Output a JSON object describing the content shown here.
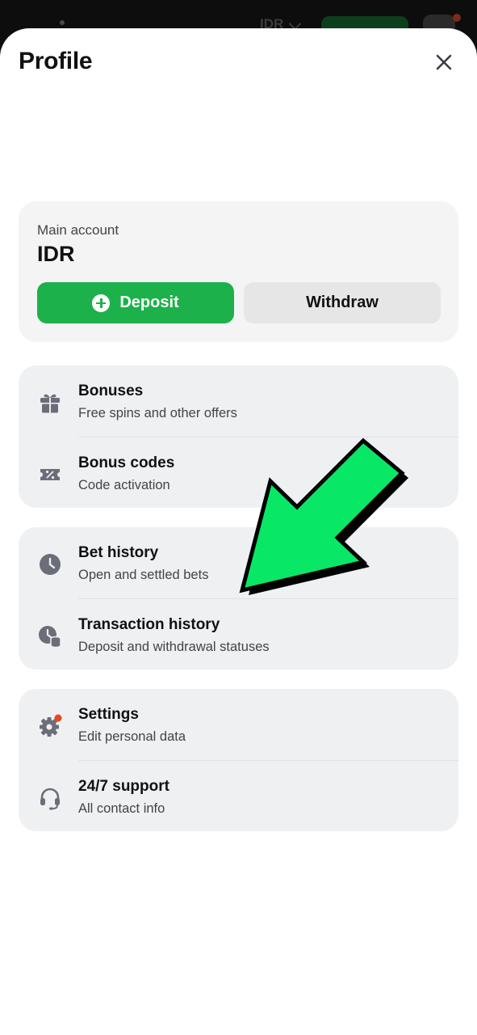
{
  "background_header": {
    "currency": "IDR"
  },
  "profile": {
    "title": "Profile"
  },
  "account": {
    "label": "Main account",
    "currency": "IDR",
    "deposit_label": "Deposit",
    "withdraw_label": "Withdraw"
  },
  "groups": [
    [
      {
        "title": "Bonuses",
        "subtitle": "Free spins and other offers",
        "icon": "gift-icon"
      },
      {
        "title": "Bonus codes",
        "subtitle": "Code activation",
        "icon": "ticket-icon"
      }
    ],
    [
      {
        "title": "Bet history",
        "subtitle": "Open and settled bets",
        "icon": "clock-icon"
      },
      {
        "title": "Transaction history",
        "subtitle": "Deposit and withdrawal statuses",
        "icon": "clock-coins-icon"
      }
    ],
    [
      {
        "title": "Settings",
        "subtitle": "Edit personal data",
        "icon": "gear-icon"
      },
      {
        "title": "24/7 support",
        "subtitle": "All contact info",
        "icon": "headset-icon"
      }
    ]
  ],
  "colors": {
    "accent_green": "#1cb14a",
    "arrow_green": "#08e866",
    "notification_red": "#e8471c",
    "icon_gray": "#6b6e78"
  }
}
